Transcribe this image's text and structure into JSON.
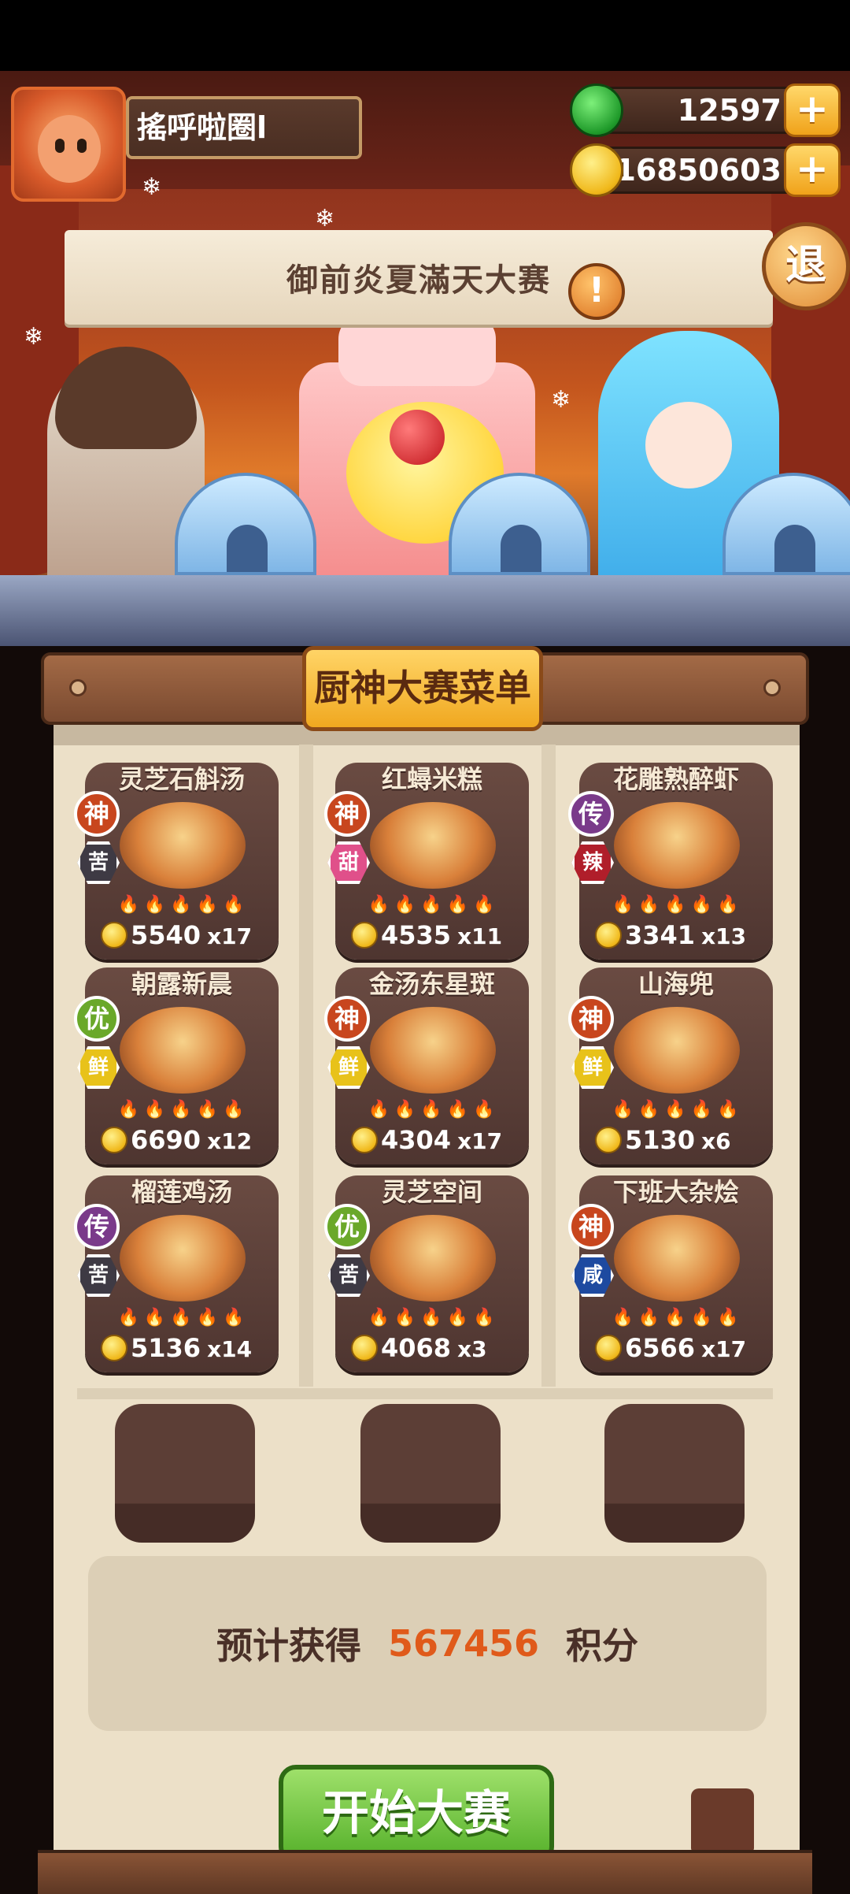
{
  "player": {
    "name": "搖呼啦圈l"
  },
  "currency": {
    "jade": "12597",
    "coins": "16850603",
    "add_label": "+"
  },
  "event": {
    "title": "御前炎夏滿天大赛",
    "alert_label": "!",
    "exit_label": "退"
  },
  "menu": {
    "title": "厨神大赛菜单",
    "dishes": [
      {
        "name": "灵芝石斛汤",
        "rank": "神",
        "flavor": "苦",
        "price": "5540",
        "qty": "x17"
      },
      {
        "name": "红蟳米糕",
        "rank": "神",
        "flavor": "甜",
        "price": "4535",
        "qty": "x11"
      },
      {
        "name": "花雕熟醉虾",
        "rank": "传",
        "flavor": "辣",
        "price": "3341",
        "qty": "x13"
      },
      {
        "name": "朝露新晨",
        "rank": "优",
        "flavor": "鲜",
        "price": "6690",
        "qty": "x12"
      },
      {
        "name": "金汤东星斑",
        "rank": "神",
        "flavor": "鲜",
        "price": "4304",
        "qty": "x17"
      },
      {
        "name": "山海兜",
        "rank": "神",
        "flavor": "鲜",
        "price": "5130",
        "qty": "x6"
      },
      {
        "name": "榴莲鸡汤",
        "rank": "传",
        "flavor": "苦",
        "price": "5136",
        "qty": "x14"
      },
      {
        "name": "灵芝空间",
        "rank": "优",
        "flavor": "苦",
        "price": "4068",
        "qty": "x3"
      },
      {
        "name": "下班大杂烩",
        "rank": "神",
        "flavor": "咸",
        "price": "6566",
        "qty": "x17"
      }
    ]
  },
  "estimate": {
    "prefix": "预计获得",
    "value": "567456",
    "suffix": "积分"
  },
  "start_button": {
    "label": "开始大赛"
  },
  "colors": {
    "rank": {
      "神": "#c8461e",
      "传": "#7a3a8a",
      "优": "#6aa82a"
    },
    "flavor": {
      "苦": "#3e3a44",
      "甜": "#e0508a",
      "辣": "#b01e2a",
      "鲜": "#e8c21a",
      "咸": "#1e4aa0"
    }
  }
}
